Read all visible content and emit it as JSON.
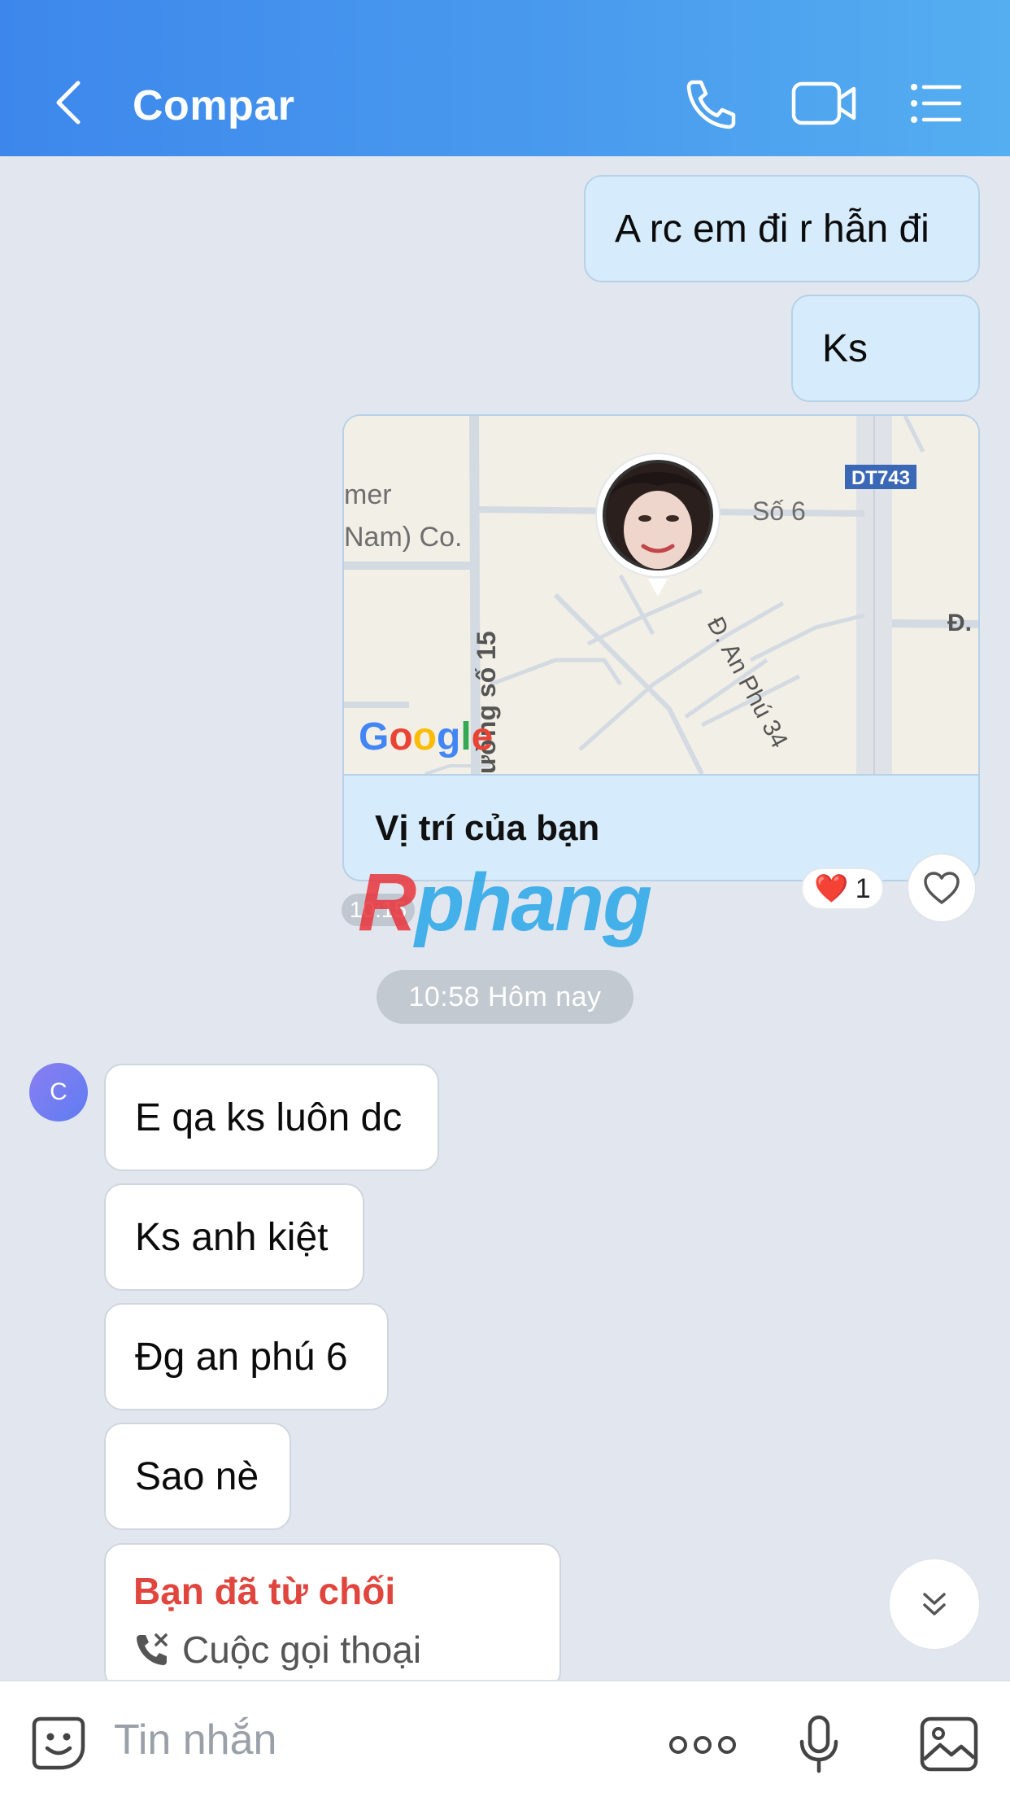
{
  "header": {
    "title": "Compar",
    "gradient_start": "#3d87ec",
    "gradient_end": "#55aef0",
    "icons": [
      "chevron-left-icon",
      "phone-icon",
      "video-icon",
      "list-menu-icon"
    ]
  },
  "messages_out": [
    {
      "text": "A rc em đi r hẫn đi"
    },
    {
      "text": "Ks"
    }
  ],
  "location": {
    "label": "Vị trí của bạn",
    "map_labels": {
      "company_line1": "mer",
      "company_line2": "Nam) Co.",
      "road_badge": "DT743",
      "street_a": "Số 6",
      "street_b": "Đ.",
      "street_c": "ường số 15",
      "street_d": "Đ. An Phú 34",
      "provider": "Google"
    },
    "time": "10:15",
    "reaction": {
      "emoji": "❤️",
      "count": "1"
    }
  },
  "watermark": {
    "first": "R",
    "rest": "phang"
  },
  "date_separator": "10:58 Hôm nay",
  "contact": {
    "avatar_initial": "C"
  },
  "messages_in": [
    {
      "text": "E qa ks luôn dc"
    },
    {
      "text": "Ks anh kiệt"
    },
    {
      "text": "Đg an phú 6"
    },
    {
      "text": "Sao nè"
    }
  ],
  "call": {
    "status": "Bạn đã từ chối",
    "type": "Cuộc gọi thoại",
    "status_color": "#e0463e"
  },
  "input_bar": {
    "placeholder": "Tin nhắn"
  }
}
